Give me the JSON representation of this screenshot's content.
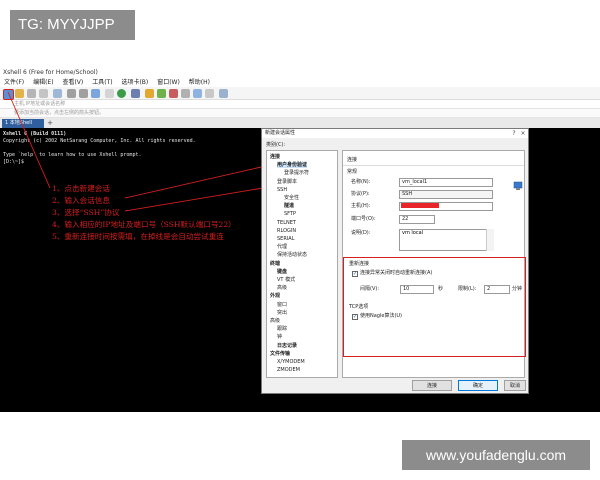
{
  "watermark_top": "TG: MYYJJPP",
  "watermark_bottom": "www.youfadenglu.com",
  "app": {
    "title": "Xshell 6 (Free for Home/School)",
    "menu": [
      "文件(F)",
      "编辑(E)",
      "查看(V)",
      "工具(T)",
      "选项卡(B)",
      "窗口(W)",
      "帮助(H)"
    ],
    "address_placeholder": "主机,IP地址或会话名称",
    "address_hint": "要添加当前会话，点击左侧的箭头按钮。",
    "tab_label": "1 本地Shell",
    "tab_add": "+"
  },
  "terminal": {
    "lines": [
      "Xshell 6 (Build 0111)",
      "Copyright (c) 2002 NetSarang Computer, Inc. All rights reserved.",
      "",
      "Type `help' to learn how to use Xshell prompt.",
      "[D:\\~]$ "
    ]
  },
  "annotations": [
    "1、点击新建会话",
    "2、输入会话信息",
    "3、选择“SSH”协议",
    "4、输入相应的IP地址及端口号（SSH默认端口号22）",
    "5、重新连接时间按需填，在掉线是会自动尝试重连"
  ],
  "dialog": {
    "title": "新建会话属性",
    "help": "?",
    "close": "×",
    "category_label": "类别(C):",
    "tree": [
      {
        "label": "连接",
        "level": 0,
        "bold": true
      },
      {
        "label": "用户身份验证",
        "level": 1,
        "bold": true,
        "selected": true
      },
      {
        "label": "登录提示符",
        "level": 2
      },
      {
        "label": "登录脚本",
        "level": 1
      },
      {
        "label": "SSH",
        "level": 1
      },
      {
        "label": "安全性",
        "level": 2
      },
      {
        "label": "隧道",
        "level": 2,
        "bold": true
      },
      {
        "label": "SFTP",
        "level": 2
      },
      {
        "label": "TELNET",
        "level": 1
      },
      {
        "label": "RLOGIN",
        "level": 1
      },
      {
        "label": "SERIAL",
        "level": 1
      },
      {
        "label": "代理",
        "level": 1
      },
      {
        "label": "保持活动状态",
        "level": 1
      },
      {
        "label": "终端",
        "level": 0,
        "bold": true
      },
      {
        "label": "键盘",
        "level": 1,
        "bold": true
      },
      {
        "label": "VT 模式",
        "level": 1
      },
      {
        "label": "高级",
        "level": 1
      },
      {
        "label": "外观",
        "level": 0,
        "bold": true
      },
      {
        "label": "窗口",
        "level": 1
      },
      {
        "label": "突出",
        "level": 1
      },
      {
        "label": "高级",
        "level": 0
      },
      {
        "label": "跟踪",
        "level": 1
      },
      {
        "label": "钟",
        "level": 1
      },
      {
        "label": "日志记录",
        "level": 1,
        "bold": true
      },
      {
        "label": "文件传输",
        "level": 0,
        "bold": true
      },
      {
        "label": "X/YMODEM",
        "level": 1
      },
      {
        "label": "ZMODEM",
        "level": 1
      }
    ],
    "section_connection": "连接",
    "section_general": "常规",
    "name_label": "名称(N):",
    "name_value": "vm_local1",
    "protocol_label": "协议(P):",
    "protocol_value": "SSH",
    "host_label": "主机(H):",
    "host_value": "",
    "host_redacted_color": "#e8262a",
    "port_label": "端口号(O):",
    "port_value": "22",
    "desc_label": "说明(D):",
    "desc_value": "vm local",
    "reconnect_section": "重新连接",
    "reconnect_checkbox": "连接异常关闭时自动重新连接(A)",
    "reconnect_checked": true,
    "interval_label": "间隔(V):",
    "interval_value": "10",
    "interval_unit": "秒",
    "limit_label": "限制(L):",
    "limit_value": "2",
    "limit_unit": "分钟",
    "tcp_section": "TCP选项",
    "nagle_checkbox": "使用Nagle算法(U)",
    "nagle_checked": true,
    "connect_button": "连接",
    "ok_button": "确定",
    "cancel_button": "取消",
    "accent_red": "#d61f1f"
  }
}
